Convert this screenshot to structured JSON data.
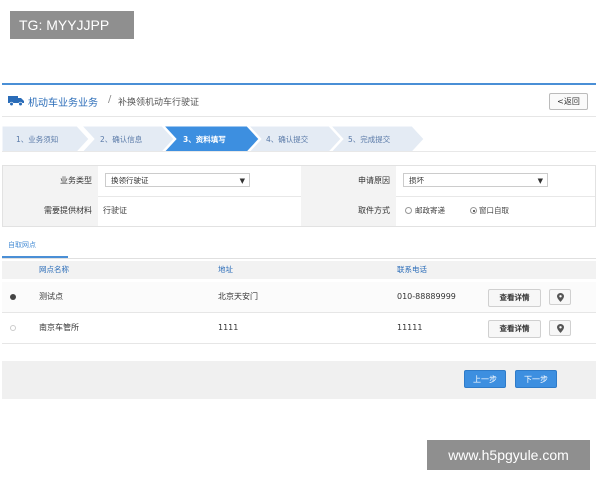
{
  "watermarks": {
    "top": "TG: MYYJJPP",
    "bottom": "www.h5pgyule.com"
  },
  "header": {
    "title": "机动车业务业务",
    "separator": "/",
    "subtitle": "补换领机动车行驶证",
    "back_label": "<返回",
    "icon": "truck-icon"
  },
  "steps": [
    {
      "label": "1、业务须知",
      "active": false
    },
    {
      "label": "2、确认信息",
      "active": false
    },
    {
      "label": "3、资料填写",
      "active": true
    },
    {
      "label": "4、确认提交",
      "active": false
    },
    {
      "label": "5、完成提交",
      "active": false
    }
  ],
  "form": {
    "business_type_label": "业务类型",
    "business_type_value": "换领行驶证",
    "reason_label": "申请原因",
    "reason_value": "损坏",
    "materials_label": "需要提供材料",
    "materials_value": "行驶证",
    "pickup_label": "取件方式",
    "pickup_options": [
      {
        "label": "邮政寄递",
        "selected": false
      },
      {
        "label": "窗口自取",
        "selected": true
      }
    ]
  },
  "tab": {
    "label": "自取网点"
  },
  "table": {
    "columns": [
      "网点名称",
      "地址",
      "联系电话"
    ],
    "rows": [
      {
        "selected": true,
        "name": "测试点",
        "address": "北京天安门",
        "phone": "010-88889999",
        "detail_label": "查看详情"
      },
      {
        "selected": false,
        "name": "南京车管所",
        "address": "1111",
        "phone": "11111",
        "detail_label": "查看详情"
      }
    ]
  },
  "footer": {
    "prev_label": "上一步",
    "next_label": "下一步"
  },
  "colors": {
    "accent": "#3d8fe0",
    "active_step": "#3d8fe0",
    "step_bg": "#dfe8f3"
  }
}
